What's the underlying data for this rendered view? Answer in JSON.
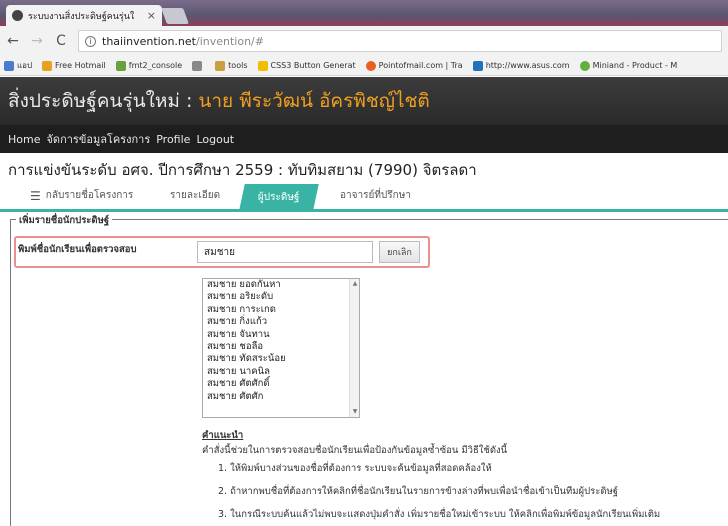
{
  "browser": {
    "tab_title": "ระบบงานสิ่งประดิษฐ์คนรุ่นใ",
    "tab_close": "×",
    "url_host": "thaiinvention.net",
    "url_path": "/invention/#",
    "back": "←",
    "forward": "→",
    "reload": "C",
    "info": "i"
  },
  "bookmarks": [
    {
      "label": "แอป",
      "color": "#4a7bd0"
    },
    {
      "label": "Free Hotmail",
      "color": "#e8a020"
    },
    {
      "label": "fmt2_console",
      "color": "#6aa040"
    },
    {
      "label": "",
      "color": "#888"
    },
    {
      "label": "tools",
      "color": "#c8a040"
    },
    {
      "label": "CSS3 Button Generat",
      "color": "#f0c000"
    },
    {
      "label": "Pointofmail.com | Tra",
      "color": "#e86020"
    },
    {
      "label": "http://www.asus.com",
      "color": "#2070c0"
    },
    {
      "label": "Miniand - Product - M",
      "color": "#60b040"
    }
  ],
  "site": {
    "title": "สิ่งประดิษฐ์คนรุ่นใหม่ : ",
    "user": "นาย พีระวัฒน์ อัครพิชญ์ไชติ",
    "nav": [
      "Home",
      "จัดการข้อมูลโครงการ",
      "Profile",
      "Logout"
    ]
  },
  "page": {
    "heading": "การแข่งขันระดับ อศจ. ปีการศึกษา 2559 : ทับทิมสยาม (7990) จิตรลดา",
    "tabs": [
      {
        "label": "กลับรายชื่อโครงการ"
      },
      {
        "label": "รายละเอียด"
      },
      {
        "label": "ผู้ประดิษฐ์"
      },
      {
        "label": "อาจารย์ที่ปรึกษา"
      }
    ],
    "legend": "เพิ่มรายชื่อนักประดิษฐ์",
    "search_label": "พิมพ์ชื่อนักเรียนเพื่อตรวจสอบ",
    "search_value": "สมชาย",
    "cancel_label": "ยกเลิก",
    "list": [
      "สมชาย ยอดกันหา",
      "สมชาย อริยะดับ",
      "สมชาย การะเกด",
      "สมชาย กิ่งแก้ว",
      "สมชาย จันทาน",
      "สมชาย ชอลือ",
      "สมชาย ทัดสระน้อย",
      "สมชาย นาคนิล",
      "สมชาย ศัตศักดิ์",
      "สมชาย ศัตศัก"
    ],
    "advice_title": "คำแนะนำ",
    "advice_text": "คำสั่งนี้ช่วยในการตรวจสอบชื่อนักเรียนเพื่อป้องกันข้อมูลซ้ำซ้อน มีวิธีใช้ดังนี้",
    "steps": [
      "1. ให้พิมพ์บางส่วนของชื่อที่ต้องการ ระบบจะค้นข้อมูลที่สอดคล้องให้",
      "2. ถ้าหากพบชื่อที่ต้องการให้คลิกที่ชื่อนักเรียนในรายการข้างล่างที่พบเพื่อนำชื่อเข้าเป็นทีมผู้ประดิษฐ์",
      "3. ในกรณีระบบค้นแล้วไม่พบจะแสดงปุ่มคำสั่ง เพิ่มรายชื่อใหม่เข้าระบบ ให้คลิกเพื่อพิมพ์ข้อมูลนักเรียนเพิ่มเติม"
    ]
  }
}
